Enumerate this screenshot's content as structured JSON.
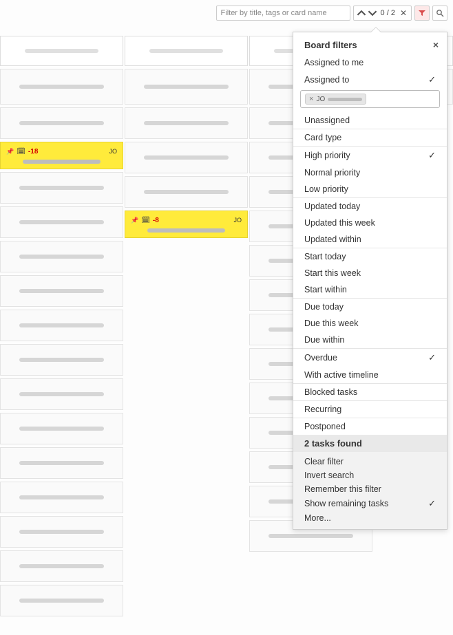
{
  "topbar": {
    "filter_placeholder": "Filter by title, tags or card name",
    "nav_count": "0 / 2"
  },
  "panel": {
    "title": "Board filters",
    "assigned_to_me": "Assigned to me",
    "assigned_to": "Assigned to",
    "assigned_chip": "JO",
    "unassigned": "Unassigned",
    "card_type": "Card type",
    "high_priority": "High priority",
    "normal_priority": "Normal priority",
    "low_priority": "Low priority",
    "updated_today": "Updated today",
    "updated_this_week": "Updated this week",
    "updated_within": "Updated within",
    "start_today": "Start today",
    "start_this_week": "Start this week",
    "start_within": "Start within",
    "due_today": "Due today",
    "due_this_week": "Due this week",
    "due_within": "Due within",
    "overdue": "Overdue",
    "with_active_timeline": "With active timeline",
    "blocked_tasks": "Blocked tasks",
    "recurring": "Recurring",
    "postponed": "Postponed",
    "tasks_found": "2 tasks found",
    "clear_filter": "Clear filter",
    "invert_search": "Invert search",
    "remember_filter": "Remember this filter",
    "show_remaining": "Show remaining tasks",
    "more": "More...",
    "check": "✓"
  },
  "cards": {
    "col1_hl_days": "-18",
    "col1_hl_assignee": "JO",
    "col2_hl_days": "-8",
    "col2_hl_assignee": "JO"
  }
}
